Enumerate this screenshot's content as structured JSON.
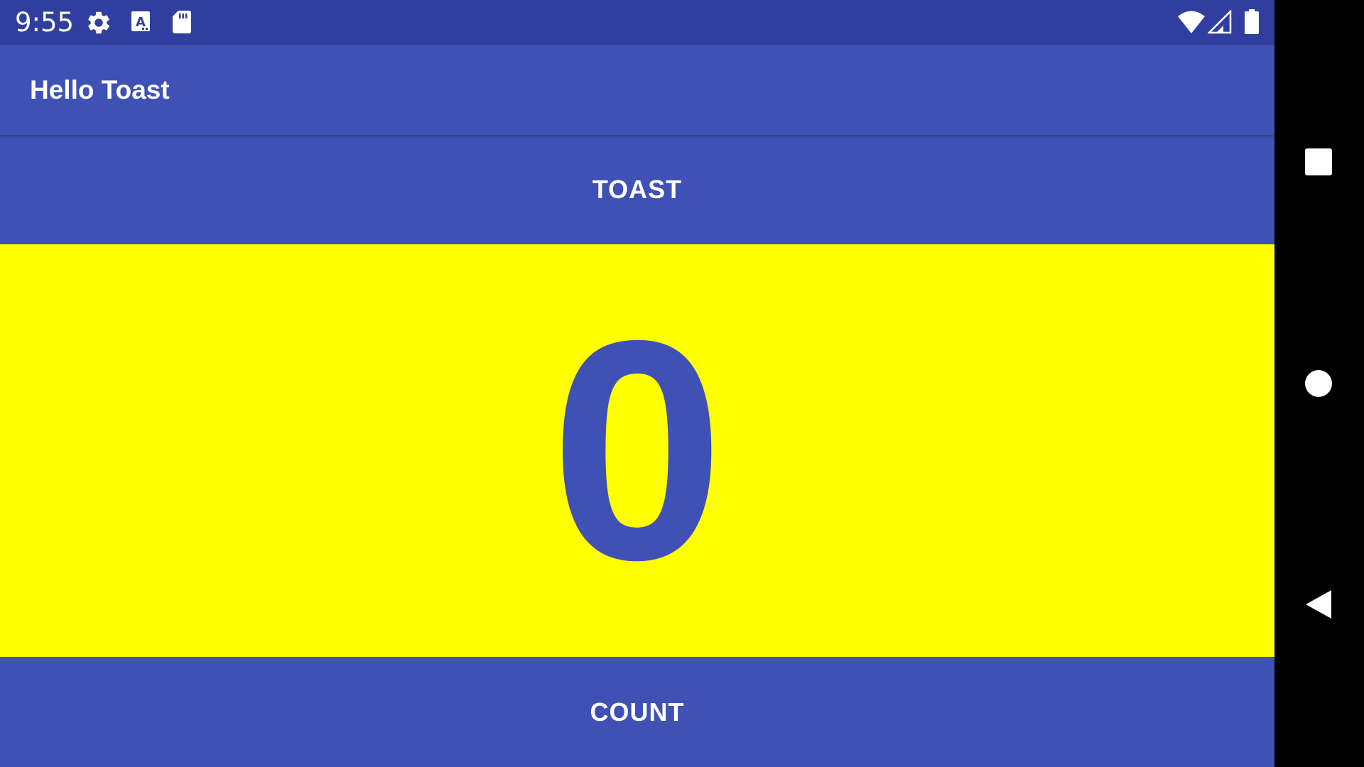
{
  "status_bar": {
    "time": "9:55",
    "left_icons": [
      "gear-icon",
      "a-keyboard-icon",
      "sd-card-icon"
    ],
    "right_icons": [
      "wifi-icon",
      "cell-signal-icon",
      "battery-icon"
    ]
  },
  "app_bar": {
    "title": "Hello Toast"
  },
  "main": {
    "toast_button_label": "TOAST",
    "count_value": "0",
    "count_button_label": "COUNT"
  },
  "nav_bar": {
    "buttons": [
      "recents-icon",
      "home-icon",
      "back-icon"
    ]
  },
  "colors": {
    "primary": "#3F51B5",
    "primary_dark": "#303F9F",
    "count_background": "#FFFF00",
    "text_on_primary": "#FFFFFF",
    "nav_background": "#000000"
  }
}
